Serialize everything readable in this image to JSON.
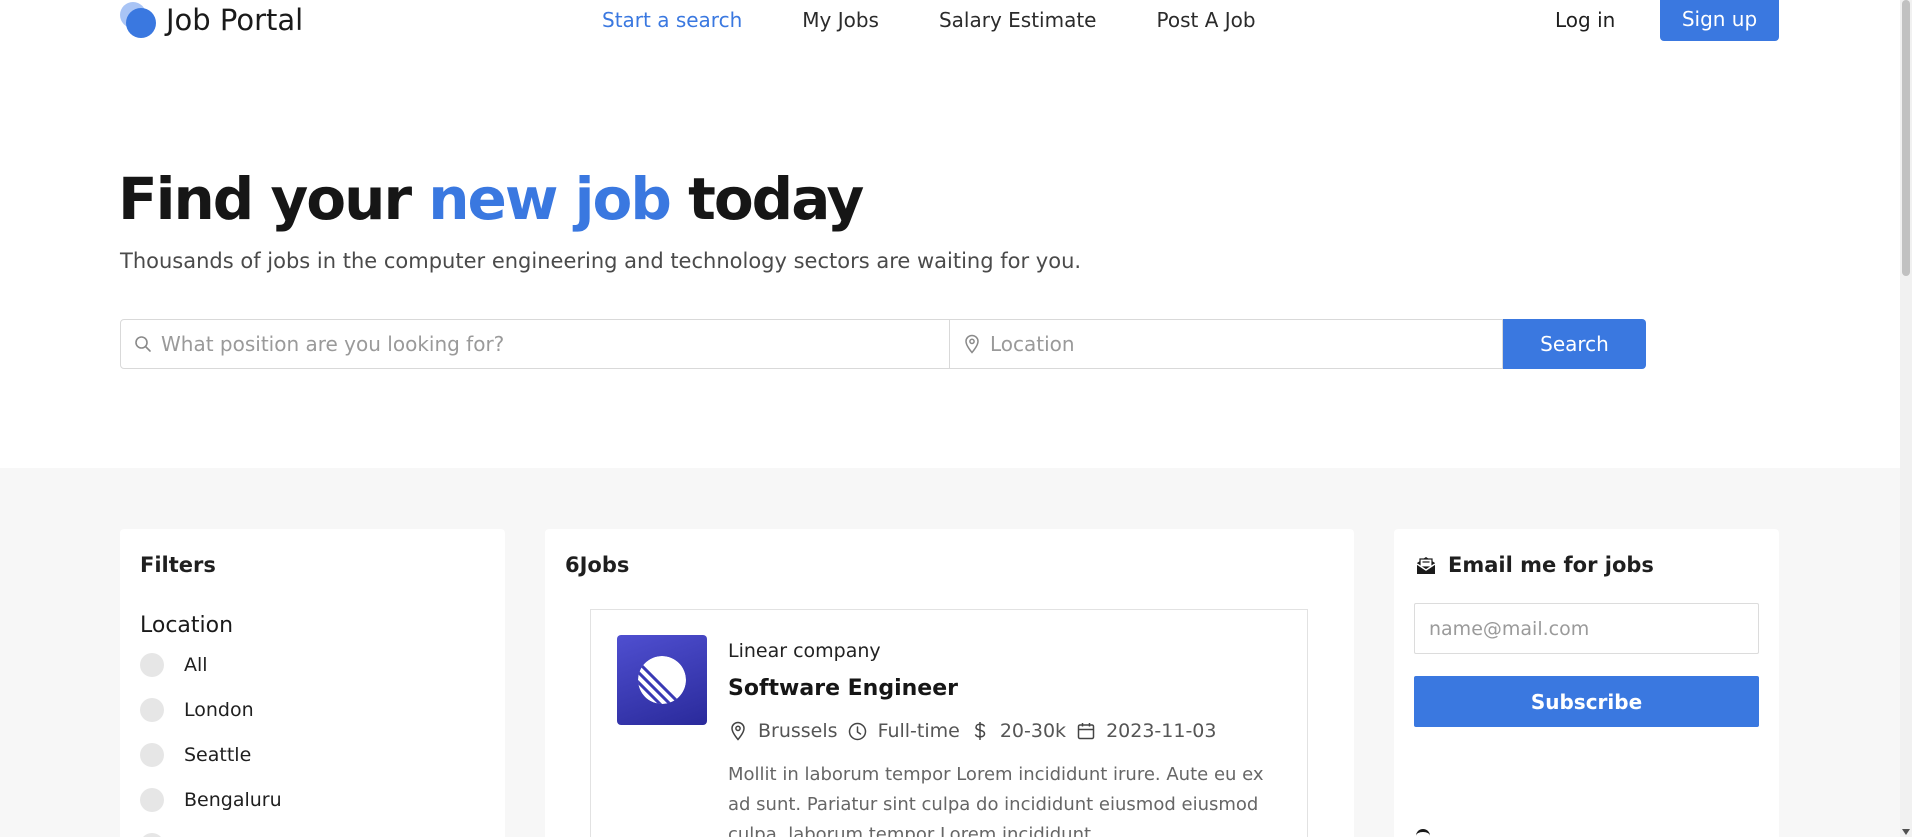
{
  "header": {
    "logo_text": "Job Portal",
    "nav": [
      {
        "label": "Start a search",
        "active": true
      },
      {
        "label": "My Jobs",
        "active": false
      },
      {
        "label": "Salary Estimate",
        "active": false
      },
      {
        "label": "Post A Job",
        "active": false
      }
    ],
    "login_label": "Log in",
    "signup_label": "Sign up"
  },
  "hero": {
    "title_part1": "Find your ",
    "title_accent": "new job",
    "title_part2": " today",
    "subtitle": "Thousands of jobs in the computer engineering and technology sectors are waiting for you."
  },
  "search": {
    "position_placeholder": "What position are you looking for?",
    "location_placeholder": "Location",
    "button_label": "Search"
  },
  "filters": {
    "title": "Filters",
    "location_heading": "Location",
    "options": [
      "All",
      "London",
      "Seattle",
      "Bengaluru"
    ]
  },
  "jobs": {
    "count_label": "6Jobs",
    "items": [
      {
        "company": "Linear company",
        "title": "Software Engineer",
        "location": "Brussels",
        "type": "Full-time",
        "salary": "20-30k",
        "date": "2023-11-03",
        "description": "Mollit in laborum tempor Lorem incididunt irure. Aute eu ex ad sunt. Pariatur sint culpa do incididunt eiusmod eiusmod culpa. laborum tempor Lorem incididunt."
      }
    ]
  },
  "email_alert": {
    "title": "Email me for jobs",
    "placeholder": "name@mail.com",
    "button_label": "Subscribe"
  },
  "colors": {
    "accent": "#3a78e0",
    "band_bg": "#f7f7f7"
  }
}
